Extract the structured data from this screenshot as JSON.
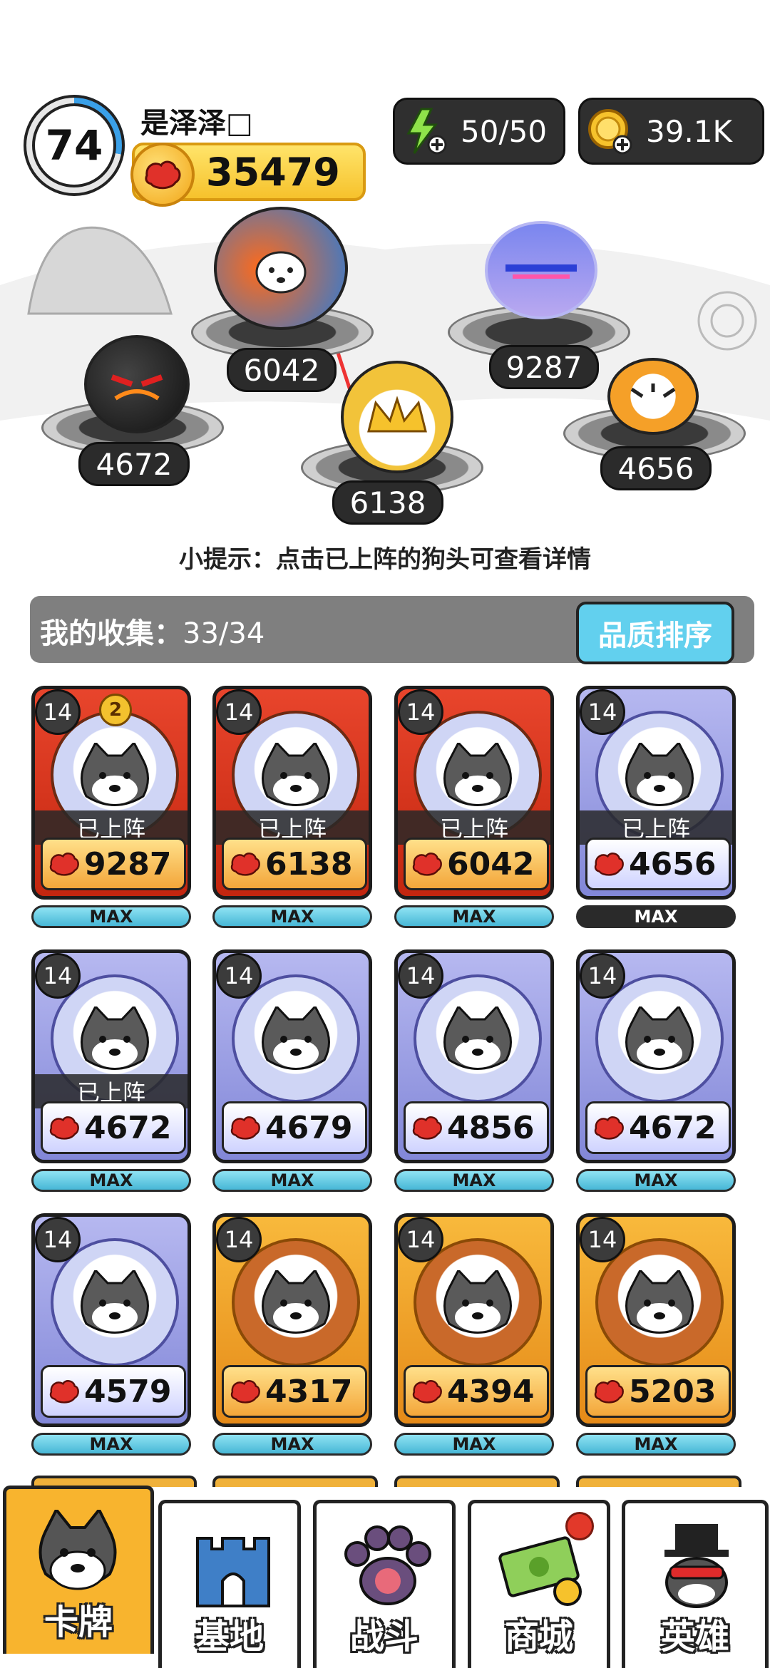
{
  "player": {
    "level": "74",
    "name": "是泽泽□",
    "power": "35479"
  },
  "resources": {
    "energy": "50/50",
    "gold": "39.1K"
  },
  "lineup": {
    "powers": [
      "6042",
      "9287",
      "4672",
      "6138",
      "4656"
    ]
  },
  "tip": "小提示：点击已上阵的狗头可查看详情",
  "collection": {
    "label": "我的收集：",
    "count": "33/34",
    "sort_button": "品质排序"
  },
  "cards": [
    {
      "level": "14",
      "star": "2",
      "deployed": "已上阵",
      "power": "9287",
      "max": "MAX",
      "rarity": "red"
    },
    {
      "level": "14",
      "deployed": "已上阵",
      "power": "6138",
      "max": "MAX",
      "rarity": "red"
    },
    {
      "level": "14",
      "deployed": "已上阵",
      "power": "6042",
      "max": "MAX",
      "rarity": "red"
    },
    {
      "level": "14",
      "deployed": "已上阵",
      "power": "4656",
      "max": "MAX",
      "rarity": "purple"
    },
    {
      "level": "14",
      "deployed": "已上阵",
      "power": "4672",
      "max": "MAX",
      "rarity": "purple"
    },
    {
      "level": "14",
      "power": "4679",
      "max": "MAX",
      "rarity": "purple"
    },
    {
      "level": "14",
      "power": "4856",
      "max": "MAX",
      "rarity": "purple"
    },
    {
      "level": "14",
      "power": "4672",
      "max": "MAX",
      "rarity": "purple"
    },
    {
      "level": "14",
      "power": "4579",
      "max": "MAX",
      "rarity": "purple"
    },
    {
      "level": "14",
      "power": "4317",
      "max": "MAX",
      "rarity": "orange"
    },
    {
      "level": "14",
      "power": "4394",
      "max": "MAX",
      "rarity": "orange"
    },
    {
      "level": "14",
      "power": "5203",
      "max": "MAX",
      "rarity": "orange"
    }
  ],
  "tabs": [
    {
      "label": "卡牌",
      "icon": "dog-head-icon",
      "active": true
    },
    {
      "label": "基地",
      "icon": "castle-icon"
    },
    {
      "label": "战斗",
      "icon": "paw-icon"
    },
    {
      "label": "商城",
      "icon": "money-icon",
      "badge": true
    },
    {
      "label": "英雄",
      "icon": "top-hat-dog-icon"
    }
  ],
  "colors": {
    "accent_orange": "#f8b42e",
    "card_red": "#e8452c",
    "card_purple": "#8287d8",
    "card_orange": "#f8b93c",
    "max_bar": "#47b7d6",
    "sort_button": "#62d0ee"
  }
}
